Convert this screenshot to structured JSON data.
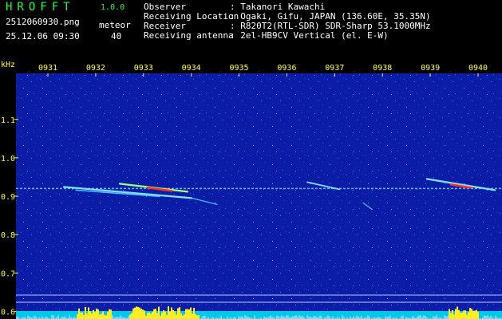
{
  "header": {
    "brand": "HROFFT",
    "version": "1.0.0",
    "filename": "2512060930.png",
    "meteor_label": "meteor",
    "datetime": "25.12.06 09:30",
    "meteor_count": "40",
    "fields": [
      {
        "label": "Observer",
        "value": ": Takanori Kawachi"
      },
      {
        "label": "Receiving Location",
        "value": ": Ogaki, Gifu, JAPAN (136.60E, 35.35N)"
      },
      {
        "label": "Receiver",
        "value": ": R820T2(RTL-SDR) SDR-Sharp 53.1000MHz"
      },
      {
        "label": "Receiving antenna",
        "value": ": 2el-HB9CV Vertical (el. E-W)"
      }
    ]
  },
  "chart_data": {
    "type": "heatmap",
    "ylabel": "kHz",
    "y_ticks": [
      "1.1",
      "1.0",
      "0.9",
      "0.8",
      "0.7",
      "0.6"
    ],
    "x_ticks": [
      "0931",
      "0932",
      "0933",
      "0934",
      "0935",
      "0936",
      "0937",
      "0938",
      "0939",
      "0940"
    ],
    "ylim": [
      0.58,
      1.22
    ],
    "carrier_khz": 0.92,
    "colors": {
      "background": "#0a1aa8",
      "carrier": "#6fc8ff",
      "hot": "#ff3020",
      "labels": "#ffff33"
    }
  }
}
